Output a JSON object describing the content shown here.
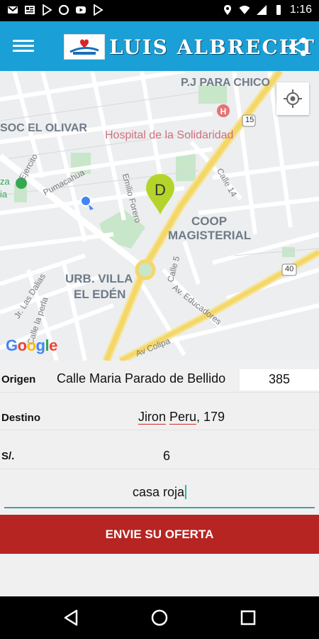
{
  "status_bar": {
    "time": "1:16",
    "left_icons": [
      "gmail-icon",
      "news-icon",
      "play-store-icon",
      "circle-app-icon",
      "youtube-icon",
      "play-store-icon"
    ],
    "right_icons": [
      "location-icon",
      "wifi-icon",
      "signal-icon",
      "battery-icon"
    ]
  },
  "app_bar": {
    "title": "LUIS ALBRECHT",
    "color": "#1a9fd6"
  },
  "map": {
    "labels": {
      "pj_para_chico": "P.J PARA CHICO",
      "soc_el_olivar": "SOC EL OLIVAR",
      "hospital": "Hospital de la Solidaridad",
      "coop_1": "COOP",
      "coop_2": "MAGISTERIAL",
      "urb_1": "URB. VILLA",
      "urb_2": "EL EDÉN",
      "pumacahua": "Pumacahua",
      "ejercito": "Ejercito",
      "emilio_forero": "Emilio Forero",
      "calle14": "Calle 14",
      "calle5": "Calle 5",
      "av_educadores": "Av. Educadores",
      "av_colipa": "Av Colipa",
      "las_dalias": "Jr. Las Dalias",
      "la_perla": "Calle la perla",
      "route_15": "15",
      "route_40": "40",
      "plaza_1": "za",
      "plaza_2": "ia",
      "google_logo": "Google",
      "marker_letter": "D"
    }
  },
  "form": {
    "origin": {
      "label": "Origen",
      "street": "Calle Maria Parado de Bellido",
      "number": "385"
    },
    "destination": {
      "label": "Destino",
      "value_word1": "Jiron",
      "value_word2": "Peru",
      "value_rest": ", 179"
    },
    "price": {
      "label": "S/.",
      "value": "6"
    },
    "reference": {
      "value": "casa roja"
    },
    "submit_label": "ENVIE SU OFERTA",
    "submit_color": "#b62522"
  }
}
